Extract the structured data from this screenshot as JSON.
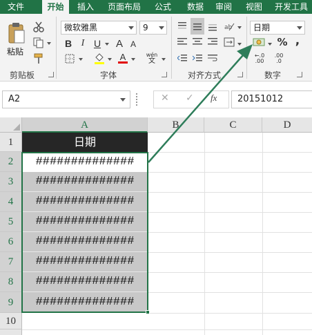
{
  "tabs": [
    "文件",
    "开始",
    "插入",
    "页面布局",
    "公式",
    "数据",
    "审阅",
    "视图",
    "开发工具"
  ],
  "active_tab": "开始",
  "ribbon": {
    "clipboard": {
      "paste_label": "粘贴",
      "group_label": "剪贴板"
    },
    "font": {
      "font_name": "微软雅黑",
      "font_size": "9",
      "bold": "B",
      "italic": "I",
      "underline": "U",
      "increase": "A",
      "decrease": "A",
      "font_color_letter": "A",
      "phonetic": "wén",
      "group_label": "字体"
    },
    "alignment": {
      "group_label": "对齐方式"
    },
    "number": {
      "format": "日期",
      "percent": "%",
      "comma": ",",
      "increase_decimal": ".00",
      "decrease_decimal": ".0",
      "group_label": "数字"
    }
  },
  "formula_bar": {
    "name_box": "A2",
    "cancel": "✕",
    "enter": "✓",
    "fx": "fx",
    "value": "20151012"
  },
  "columns": [
    "A",
    "B",
    "C",
    "D"
  ],
  "rows": [
    "1",
    "2",
    "3",
    "4",
    "5",
    "6",
    "7",
    "8",
    "9",
    "10"
  ],
  "header_cell": "日期",
  "cells": [
    "##############",
    "##############",
    "##############",
    "##############",
    "##############",
    "##############",
    "##############",
    "##############"
  ],
  "colors": {
    "accent": "#217346",
    "header_bg": "#262626",
    "shade": "#c8c8c8"
  }
}
